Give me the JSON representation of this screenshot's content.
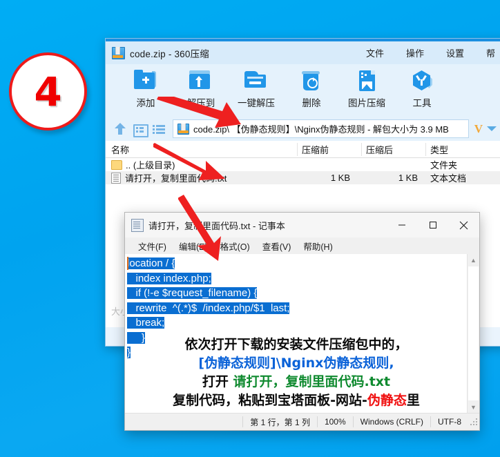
{
  "badge": {
    "number": "4"
  },
  "zip_window": {
    "icon": "zip-archive-icon",
    "title": "code.zip - 360压缩",
    "menus": [
      "文件",
      "操作",
      "设置",
      "帮"
    ],
    "toolbar": [
      {
        "icon": "add-folder-icon",
        "label": "添加"
      },
      {
        "icon": "extract-to-icon",
        "label": "解压到"
      },
      {
        "icon": "one-click-extract-icon",
        "label": "一键解压"
      },
      {
        "icon": "trash-icon",
        "label": "删除"
      },
      {
        "icon": "image-compress-icon",
        "label": "图片压缩"
      },
      {
        "icon": "tools-icon",
        "label": "工具"
      }
    ],
    "address_bar": {
      "up_icon": "up-arrow-icon",
      "view_icon": "view-pane-icon",
      "list_icon": "list-view-icon",
      "file_icon": "zip-archive-icon",
      "path": "code.zip\\ 【伪静态规则】\\Nginx伪静态规则 - 解包大小为 3.9 MB",
      "v_logo": "V",
      "dropdown_icon": "chevron-down-icon"
    },
    "columns": [
      "名称",
      "压缩前",
      "压缩后",
      "类型"
    ],
    "rows": [
      {
        "icon": "folder-icon",
        "name": ".. (上级目录)",
        "before": "",
        "after": "",
        "type": "文件夹"
      },
      {
        "icon": "text-file-icon",
        "name": "请打开，复制里面代码.txt",
        "before": "1 KB",
        "after": "1 KB",
        "type": "文本文档"
      }
    ],
    "ghost_text": "大小"
  },
  "notepad": {
    "icon": "notepad-icon",
    "title": "请打开，复制里面代码.txt - 记事本",
    "window_controls": [
      {
        "icon": "minimize-icon"
      },
      {
        "icon": "maximize-icon"
      },
      {
        "icon": "close-icon"
      }
    ],
    "menus": [
      "文件(F)",
      "编辑(E)",
      "格式(O)",
      "查看(V)",
      "帮助(H)"
    ],
    "code_lines": [
      "location / {",
      "   index index.php;",
      "   if (!-e $request_filename) {",
      "   rewrite  ^(.*)$  /index.php/$1  last;",
      "   break;",
      "     }",
      "}"
    ],
    "scrollbar": {
      "up_icon": "scroll-up-icon",
      "down_icon": "scroll-down-icon"
    },
    "status": {
      "position": "第 1 行，第 1 列",
      "zoom": "100%",
      "line_ending": "Windows (CRLF)",
      "encoding": "UTF-8",
      "grip_icon": "resize-grip-icon"
    }
  },
  "annotation": {
    "line1": "依次打开下载的安装文件压缩包中的，",
    "line2": "[伪静态规则]\\Nginx伪静态规则,",
    "line3_prefix": "打开 ",
    "line3_file": "请打开，复制里面代码.txt",
    "line4_prefix": "复制代码，粘贴到宝塔面板-网站-",
    "line4_red": "伪静态",
    "line4_suffix": "里",
    "colors": {
      "black": "#0b0b0b",
      "blue": "#0a62d8",
      "green": "#0f8a2f",
      "red": "#f01010"
    }
  },
  "arrows": [
    {
      "name": "arrow-to-address-bar"
    },
    {
      "name": "arrow-to-file-row"
    },
    {
      "name": "arrow-to-notepad-code"
    }
  ],
  "theme": {
    "desktop": "#00a6f0",
    "badge_ring": "#ee1b1b",
    "badge_number": "#f00000",
    "selection": "#0a6ed1"
  }
}
